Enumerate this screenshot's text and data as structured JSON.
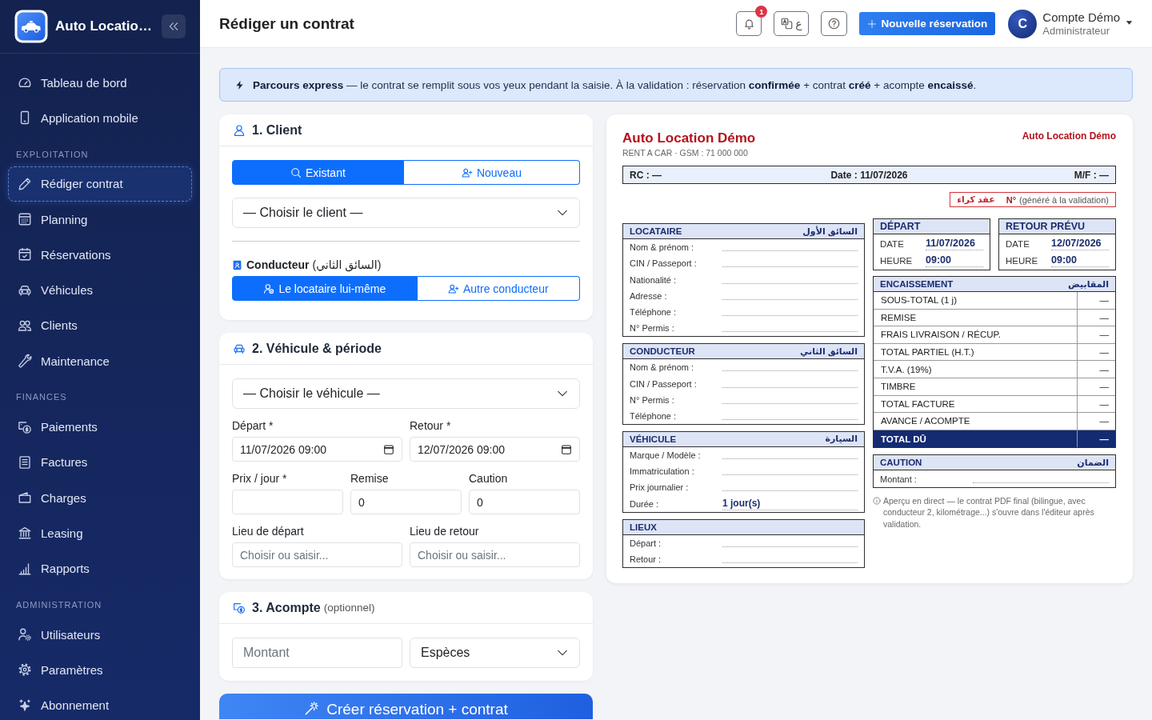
{
  "sidebar": {
    "brand": "Auto Locatio…",
    "sections": [
      {
        "items": [
          {
            "label": "Tableau de bord",
            "selected": false
          },
          {
            "label": "Application mobile",
            "selected": false
          }
        ]
      },
      {
        "title": "EXPLOITATION",
        "items": [
          {
            "label": "Rédiger contrat",
            "selected": true
          },
          {
            "label": "Planning",
            "selected": false
          },
          {
            "label": "Réservations",
            "selected": false
          },
          {
            "label": "Véhicules",
            "selected": false
          },
          {
            "label": "Clients",
            "selected": false
          },
          {
            "label": "Maintenance",
            "selected": false
          }
        ]
      },
      {
        "title": "FINANCES",
        "items": [
          {
            "label": "Paiements",
            "selected": false
          },
          {
            "label": "Factures",
            "selected": false
          },
          {
            "label": "Charges",
            "selected": false
          },
          {
            "label": "Leasing",
            "selected": false
          },
          {
            "label": "Rapports",
            "selected": false
          }
        ]
      },
      {
        "title": "ADMINISTRATION",
        "items": [
          {
            "label": "Utilisateurs",
            "selected": false
          },
          {
            "label": "Paramètres",
            "selected": false
          },
          {
            "label": "Abonnement",
            "selected": false
          }
        ]
      }
    ]
  },
  "topbar": {
    "title": "Rédiger un contrat",
    "notifications": {
      "count": "1"
    },
    "language_button": {
      "label": "ع"
    },
    "new_reservation_button": {
      "label": "Nouvelle réservation"
    },
    "user": {
      "initial": "C",
      "name": "Compte Démo",
      "role": "Administrateur"
    }
  },
  "banner": {
    "text": "**Parcours express** — le contrat se remplit sous vos yeux pendant la saisie. À la validation : réservation **confirmée** + contrat **créé** + acompte **encaissé**."
  },
  "client_card": {
    "title": "1. Client",
    "mode_tabs": [
      {
        "label": "Existant",
        "selected": true
      },
      {
        "label": "Nouveau",
        "selected": false
      }
    ],
    "client_select": {
      "value": "— Choisir le client —"
    },
    "driver_label": "**Conducteur** (السائق الثاني)",
    "driver_tabs": [
      {
        "label": "Le locataire lui-même",
        "selected": true
      },
      {
        "label": "Autre conducteur",
        "selected": false
      }
    ]
  },
  "vehicle_card": {
    "title": "2. Véhicule & période",
    "vehicle_select": {
      "value": "— Choisir le véhicule —"
    },
    "rows": [
      [
        {
          "label": "Départ *",
          "kind": "datetime",
          "value": "11/07/2026 09:00"
        },
        {
          "label": "Retour *",
          "kind": "datetime",
          "value": "12/07/2026 09:00"
        }
      ],
      [
        {
          "label": "Prix / jour *",
          "kind": "number"
        },
        {
          "label": "Remise",
          "kind": "number",
          "value": "0"
        },
        {
          "label": "Caution",
          "kind": "number",
          "value": "0"
        }
      ],
      [
        {
          "label": "Lieu de départ",
          "kind": "text",
          "placeholder": "Choisir ou saisir..."
        },
        {
          "label": "Lieu de retour",
          "kind": "text",
          "placeholder": "Choisir ou saisir..."
        }
      ]
    ]
  },
  "deposit_card": {
    "title": "3. Acompte",
    "note": "(optionnel)",
    "amount": {
      "placeholder": "Montant"
    },
    "method_select": {
      "value": "Espèces"
    }
  },
  "submit_button": {
    "label": "Créer réservation + contrat"
  },
  "preview": {
    "company": "Auto Location Démo",
    "tagline": "RENT A CAR · GSM : 71 000 000",
    "company_short": "Auto Location Démo",
    "header_fields": [
      "RC : —",
      "Date : 11/07/2026",
      "M/F : —"
    ],
    "contract_number": {
      "title": "عقد كراء",
      "label": "N°",
      "hint": "(généré à la validation)"
    },
    "left_sections": [
      {
        "title": "LOCATAIRE",
        "title_ar": "السائق الأول",
        "rows": [
          {
            "label": "Nom & prénom :"
          },
          {
            "label": "CIN / Passeport :"
          },
          {
            "label": "Nationalité :"
          },
          {
            "label": "Adresse :"
          },
          {
            "label": "Téléphone :"
          },
          {
            "label": "N° Permis :"
          }
        ]
      },
      {
        "title": "CONDUCTEUR",
        "title_ar": "السائق الثاني",
        "rows": [
          {
            "label": "Nom & prénom :"
          },
          {
            "label": "CIN / Passeport :"
          },
          {
            "label": "N° Permis :"
          },
          {
            "label": "Téléphone :"
          }
        ]
      },
      {
        "title": "VÉHICULE",
        "title_ar": "السيارة",
        "rows": [
          {
            "label": "Marque / Modèle :"
          },
          {
            "label": "Immatriculation :"
          },
          {
            "label": "Prix journalier :"
          },
          {
            "label": "Durée :",
            "value": "1 jour(s)"
          }
        ]
      },
      {
        "title": "LIEUX",
        "rows": [
          {
            "label": "Départ :"
          },
          {
            "label": "Retour :"
          }
        ]
      }
    ],
    "schedule": [
      {
        "title": "DÉPART",
        "rows": [
          {
            "label": "DATE",
            "value": "11/07/2026"
          },
          {
            "label": "HEURE",
            "value": "09:00"
          }
        ]
      },
      {
        "title": "RETOUR PRÉVU",
        "rows": [
          {
            "label": "DATE",
            "value": "12/07/2026"
          },
          {
            "label": "HEURE",
            "value": "09:00"
          }
        ]
      }
    ],
    "payments": {
      "title": "ENCAISSEMENT",
      "title_ar": "المقابيض",
      "rows": [
        {
          "label": "SOUS-TOTAL (1 j)",
          "value": "—",
          "kind": "line"
        },
        {
          "label": "REMISE",
          "value": "—",
          "kind": "line"
        },
        {
          "label": "FRAIS LIVRAISON / RÉCUP.",
          "value": "—",
          "kind": "line"
        },
        {
          "label": "TOTAL PARTIEL (H.T.)",
          "value": "—",
          "kind": "line"
        },
        {
          "label": "T.V.A. (19%)",
          "value": "—",
          "kind": "line"
        },
        {
          "label": "TIMBRE",
          "value": "—",
          "kind": "line"
        },
        {
          "label": "TOTAL FACTURE",
          "value": "—",
          "kind": "line"
        },
        {
          "label": "AVANCE / ACOMPTE",
          "value": "—",
          "kind": "line"
        },
        {
          "label": "TOTAL DÛ",
          "value": "—",
          "kind": "total"
        }
      ]
    },
    "caution": {
      "title": "CAUTION",
      "title_ar": "الضمان",
      "rows": [
        {
          "label": "Montant :"
        }
      ]
    },
    "note": "Aperçu en direct — le contrat PDF final (bilingue, avec conducteur 2, kilométrage...) s'ouvre dans l'éditeur après validation."
  }
}
